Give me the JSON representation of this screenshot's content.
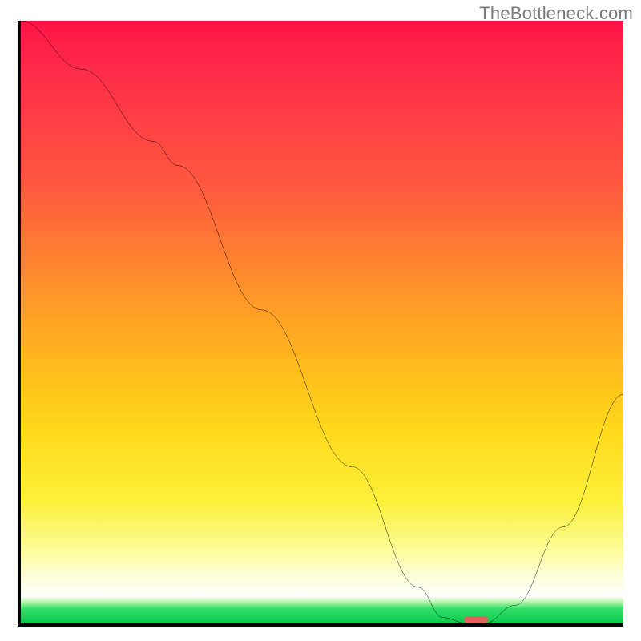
{
  "watermark": "TheBottleneck.com",
  "chart_data": {
    "type": "line",
    "title": "",
    "xlabel": "",
    "ylabel": "",
    "xlim": [
      0,
      100
    ],
    "ylim": [
      0,
      100
    ],
    "grid": false,
    "legend": false,
    "background_gradient": {
      "direction": "vertical",
      "stops": [
        {
          "pct": 0,
          "color": "#ff1446"
        },
        {
          "pct": 28,
          "color": "#ff5a3e"
        },
        {
          "pct": 55,
          "color": "#ffb41e"
        },
        {
          "pct": 80,
          "color": "#fdf03b"
        },
        {
          "pct": 92,
          "color": "#fbfed6"
        },
        {
          "pct": 96,
          "color": "#ffffff"
        },
        {
          "pct": 100,
          "color": "#08c94e"
        }
      ]
    },
    "series": [
      {
        "name": "bottleneck-curve",
        "color": "#000000",
        "x": [
          0,
          10,
          22,
          26,
          40,
          55,
          66,
          70,
          74,
          77,
          82,
          90,
          100
        ],
        "values": [
          100,
          92,
          80,
          76,
          52,
          26,
          6,
          1,
          0,
          0,
          3,
          16,
          38
        ]
      }
    ],
    "marker": {
      "name": "optimal-point-pill",
      "color": "#e0625f",
      "x_center": 75.5,
      "y": 0,
      "width_pct": 4,
      "height_pct": 1.2
    }
  }
}
